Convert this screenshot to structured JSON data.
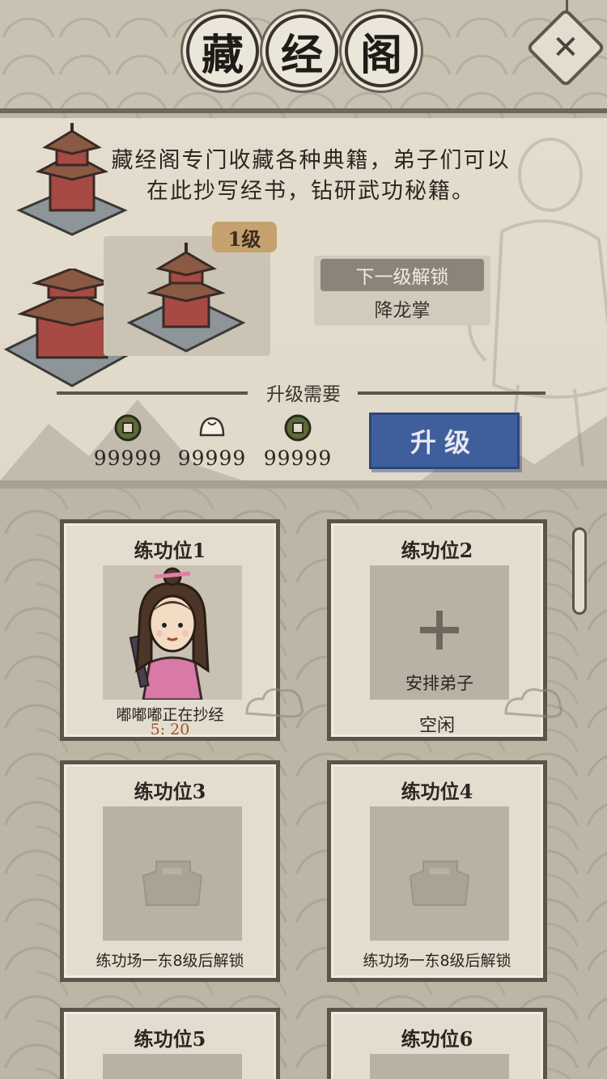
{
  "header": {
    "title_chars": [
      "藏",
      "经",
      "阁"
    ],
    "close_icon": "close-icon"
  },
  "info": {
    "description_line1": "藏经阁专门收藏各种典籍，弟子们可以",
    "description_line2": "在此抄写经书，钻研武功秘籍。",
    "level_badge": "1级",
    "next_unlock_title": "下一级解锁",
    "next_unlock_skill": "降龙掌",
    "requirement_label": "升级需要",
    "costs": [
      {
        "icon": "copper-coin-icon",
        "value": "99999"
      },
      {
        "icon": "steamed-bun-icon",
        "value": "99999"
      },
      {
        "icon": "copper-coin-icon",
        "value": "99999"
      }
    ],
    "upgrade_button": "升级"
  },
  "slots": [
    {
      "title": "练功位1",
      "state": "occupied",
      "status": "嘟嘟嘟正在抄经",
      "timer": "5: 20"
    },
    {
      "title": "练功位2",
      "state": "empty",
      "assign_label": "安排弟子",
      "status": "空闲"
    },
    {
      "title": "练功位3",
      "state": "locked",
      "status": "练功场一东8级后解锁"
    },
    {
      "title": "练功位4",
      "state": "locked",
      "status": "练功场一东8级后解锁"
    },
    {
      "title": "练功位5",
      "state": "locked"
    },
    {
      "title": "练功位6",
      "state": "locked"
    }
  ],
  "colors": {
    "upgrade_button": "#3f5f9c",
    "level_badge": "#c4a16f",
    "timer": "#a0532c"
  }
}
